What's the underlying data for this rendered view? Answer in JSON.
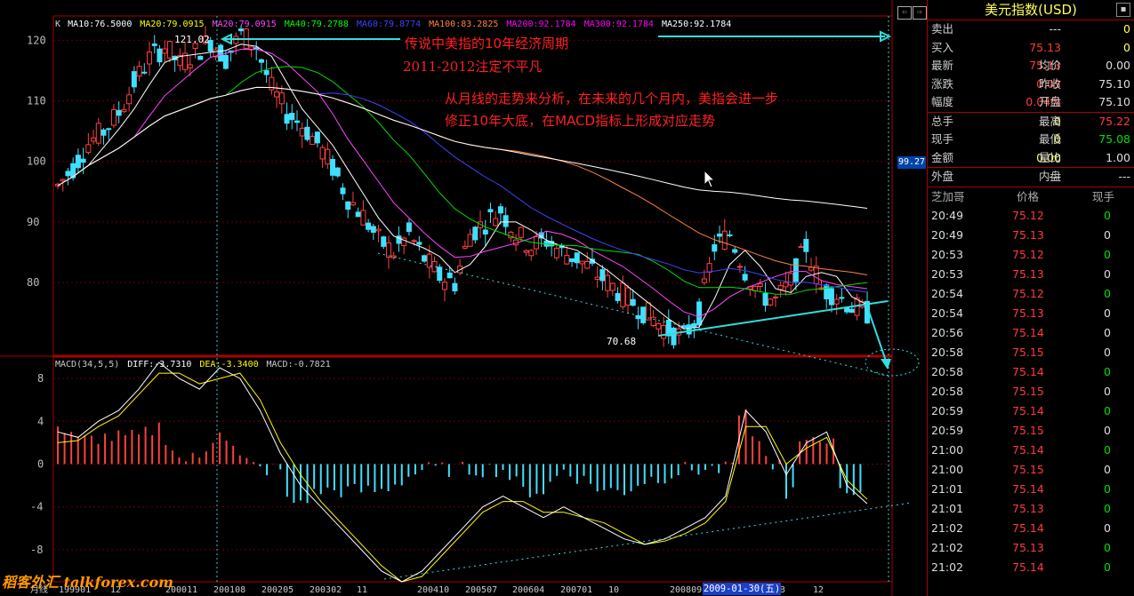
{
  "header": {
    "main_legend": [
      {
        "text": "K",
        "color": "#cccccc"
      },
      {
        "text": "MA10:76.5000",
        "color": "#ffffff"
      },
      {
        "text": "MA20:79.0915",
        "color": "#ffff00"
      },
      {
        "text": "MA20:79.0915",
        "color": "#ff44ff"
      },
      {
        "text": "MA40:79.2788",
        "color": "#00ff00"
      },
      {
        "text": "MA60:79.8774",
        "color": "#4040ff"
      },
      {
        "text": "MA100:83.2825",
        "color": "#ff8040"
      },
      {
        "text": "MA200:92.1784",
        "color": "#ff00ff"
      },
      {
        "text": "MA300:92.1784",
        "color": "#ff00ff"
      },
      {
        "text": "MA250:92.1784",
        "color": "#ffffff"
      }
    ],
    "macd_legend": [
      {
        "text": "MACD(34,5,5)",
        "color": "#cccccc"
      },
      {
        "text": "DIFF:-3.7310",
        "color": "#ffffff"
      },
      {
        "text": "DEA:-3.3400",
        "color": "#ffff00"
      },
      {
        "text": "MACD:-0.7821",
        "color": "#cccccc"
      }
    ]
  },
  "annotations": {
    "line1": "传说中美指的10年经济周期",
    "line2": "2011-2012注定不平凡",
    "line3": "从月线的走势来分析，在未来的几个月内，美指会进一步",
    "line4": "修正10年大底，在MACD指标上形成对应走势",
    "high_label": "121.02",
    "low_label": "70.68",
    "price_tag": "99.27",
    "cursor_date": "2009-01-30(五)",
    "watermark": "稻客外汇 talkforex.com",
    "period_label": "月线"
  },
  "chart_data": [
    {
      "type": "candlestick",
      "title": "",
      "yticks": [
        80,
        90,
        100,
        110,
        120
      ],
      "ylim": [
        68,
        124
      ],
      "xticks": [
        "199901",
        "12",
        "200011",
        "200108",
        "200205",
        "200302",
        "11",
        "200410",
        "200507",
        "200604",
        "200701",
        "10",
        "200809",
        "2009-01-30",
        "03",
        "12"
      ],
      "close_path": [
        96,
        99,
        103,
        105,
        108,
        113,
        117,
        119,
        116,
        118,
        120,
        117,
        121,
        119,
        112,
        108,
        106,
        103,
        99,
        94,
        91,
        87,
        85,
        88,
        84,
        81,
        80,
        88,
        90,
        92,
        88,
        86,
        87,
        85,
        84,
        82,
        80,
        78,
        76,
        74,
        72,
        71,
        75,
        86,
        88,
        82,
        78,
        77,
        80,
        86,
        79,
        78,
        76,
        75
      ],
      "high": 121.02,
      "low": 70.68,
      "last": 75.13
    },
    {
      "type": "line",
      "title": "MACD(34,5,5)",
      "yticks": [
        -8,
        -4,
        0,
        4,
        8
      ],
      "ylim": [
        -11,
        10
      ],
      "series": [
        {
          "name": "DIFF",
          "values": [
            3,
            2.5,
            4,
            5,
            7,
            9.5,
            8,
            7,
            9,
            8,
            5,
            1,
            -2,
            -4,
            -6,
            -8,
            -10,
            -11,
            -10,
            -8,
            -6,
            -4,
            -3,
            -4,
            -5,
            -4,
            -5,
            -6,
            -7,
            -7.5,
            -7,
            -6,
            -5,
            -3,
            5,
            3,
            -1,
            2,
            3,
            -2,
            -3.7
          ]
        },
        {
          "name": "DEA",
          "values": [
            2,
            2.2,
            3.5,
            4.5,
            6.5,
            8.5,
            8.5,
            7.5,
            8,
            8.5,
            6,
            2,
            -1,
            -3.5,
            -5.5,
            -7.5,
            -9.5,
            -11,
            -10.5,
            -8.5,
            -6.5,
            -4.5,
            -3.5,
            -3.5,
            -4.5,
            -4.5,
            -5,
            -5.5,
            -6.5,
            -7.5,
            -7.2,
            -6.5,
            -5.5,
            -3.5,
            3.5,
            3.5,
            0,
            1.5,
            2.5,
            -1.5,
            -3.3
          ]
        }
      ]
    }
  ],
  "quote_panel": {
    "title": "美元指数(USD)",
    "rows": [
      {
        "l1": "卖出",
        "v1": "---",
        "c1": "white",
        "l2": "",
        "v2": "0",
        "c2": "yellow"
      },
      {
        "l1": "买入",
        "v1": "75.13",
        "c1": "red",
        "l2": "",
        "v2": "0",
        "c2": "yellow"
      },
      {
        "l1": "最新",
        "v1": "75.13",
        "c1": "red",
        "l2": "均价",
        "v2": "0.00",
        "c2": "white"
      },
      {
        "l1": "涨跌",
        "v1": "0.03",
        "c1": "red",
        "l2": "昨收",
        "v2": "75.10",
        "c2": "white"
      },
      {
        "l1": "幅度",
        "v1": "0.04%",
        "c1": "red",
        "l2": "开盘",
        "v2": "75.10",
        "c2": "white"
      },
      {
        "l1": "总手",
        "v1": "0",
        "c1": "yellow",
        "l2": "最高",
        "v2": "75.22",
        "c2": "red"
      },
      {
        "l1": "现手",
        "v1": "0",
        "c1": "yellow",
        "l2": "最低",
        "v2": "75.08",
        "c2": "green"
      },
      {
        "l1": "金额",
        "v1": "0.00",
        "c1": "yellow",
        "l2": "量比",
        "v2": "1.00",
        "c2": "white"
      },
      {
        "l1": "外盘",
        "v1": "---",
        "c1": "white",
        "l2": "内盘",
        "v2": "---",
        "c2": "white"
      }
    ],
    "ticks_header": {
      "time": "芝加哥",
      "price": "价格",
      "vol": "现手"
    },
    "ticks": [
      {
        "time": "20:49",
        "price": "75.12",
        "vol": "0",
        "vc": "green"
      },
      {
        "time": "20:49",
        "price": "75.13",
        "vol": "0",
        "vc": "white"
      },
      {
        "time": "20:53",
        "price": "75.12",
        "vol": "0",
        "vc": "green"
      },
      {
        "time": "20:53",
        "price": "75.13",
        "vol": "0",
        "vc": "white"
      },
      {
        "time": "20:54",
        "price": "75.12",
        "vol": "0",
        "vc": "green"
      },
      {
        "time": "20:54",
        "price": "75.13",
        "vol": "0",
        "vc": "white"
      },
      {
        "time": "20:56",
        "price": "75.14",
        "vol": "0",
        "vc": "white"
      },
      {
        "time": "20:58",
        "price": "75.15",
        "vol": "0",
        "vc": "white"
      },
      {
        "time": "20:58",
        "price": "75.14",
        "vol": "0",
        "vc": "green"
      },
      {
        "time": "20:58",
        "price": "75.15",
        "vol": "0",
        "vc": "white"
      },
      {
        "time": "20:59",
        "price": "75.14",
        "vol": "0",
        "vc": "green"
      },
      {
        "time": "20:59",
        "price": "75.15",
        "vol": "0",
        "vc": "white"
      },
      {
        "time": "21:00",
        "price": "75.14",
        "vol": "0",
        "vc": "green"
      },
      {
        "time": "21:00",
        "price": "75.15",
        "vol": "0",
        "vc": "white"
      },
      {
        "time": "21:01",
        "price": "75.14",
        "vol": "0",
        "vc": "green"
      },
      {
        "time": "21:01",
        "price": "75.13",
        "vol": "0",
        "vc": "green"
      },
      {
        "time": "21:02",
        "price": "75.14",
        "vol": "0",
        "vc": "white"
      },
      {
        "time": "21:02",
        "price": "75.13",
        "vol": "0",
        "vc": "green"
      },
      {
        "time": "21:02",
        "price": "75.14",
        "vol": "0",
        "vc": "green"
      }
    ]
  }
}
